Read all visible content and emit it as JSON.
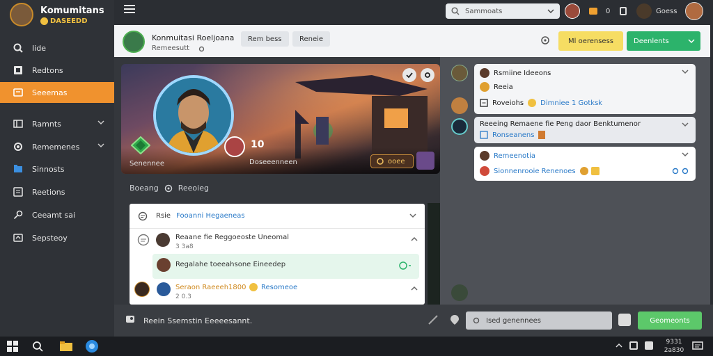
{
  "app": {
    "brand_title": "Komumitans",
    "brand_sub": "ᗞᗅᎴᏋᏚᏒᏒᏫ",
    "brand_sub_text": "DASEEDD"
  },
  "sidebar": {
    "items": [
      {
        "label": "Iide",
        "icon": "search-icon"
      },
      {
        "label": "Redtons",
        "icon": "bookmark-icon"
      },
      {
        "label": "Seeemas",
        "icon": "chat-icon",
        "active": true
      },
      {
        "label": "Ramnts",
        "icon": "grid-icon",
        "has_chevron": true
      },
      {
        "label": "Rememenes",
        "icon": "gear-icon",
        "has_chevron": true
      },
      {
        "label": "Sinnosts",
        "icon": "folder-icon"
      },
      {
        "label": "Reetions",
        "icon": "document-icon"
      },
      {
        "label": "Ceeamt sai",
        "icon": "key-icon"
      },
      {
        "label": "Sepsteoy",
        "icon": "share-icon"
      }
    ]
  },
  "topbar": {
    "search_placeholder": "Sammoats",
    "badge_text": "0",
    "user_name": "Goess"
  },
  "header": {
    "profile_name": "Konmuitasi Roeljoana",
    "profile_sub": "Remeesutt",
    "chips": [
      "Rem bess",
      "Reneie"
    ],
    "btn_yellow": "Ml oerensess",
    "btn_green": "Deenlents"
  },
  "hero": {
    "score": "10",
    "caption": "Senennee",
    "sub_caption": "Doseeenneen",
    "pill_label": "ooee"
  },
  "section": {
    "title_left": "Boeang",
    "title_right": "Reeoieg"
  },
  "comments": {
    "head_label": "Rsie",
    "head_link": "Fooanni Hegaeneas",
    "rows": [
      {
        "text": "Reaane fie Reggoeoste Uneomal",
        "sub": "3 3a8"
      },
      {
        "text": "Regalahe toeeahsone Eineedep",
        "sub": ""
      },
      {
        "text": "Seraon Raeeeh1800",
        "link": "Resomeoe",
        "sub": "2 0.3"
      }
    ]
  },
  "right_panel": {
    "card1": {
      "title": "Rsmiine Ideeons",
      "sub": "Reeia",
      "line": "Roveiohs",
      "link": "Dimniee 1 Gotksk"
    },
    "card2": {
      "title": "Reeeing Remaene fie Peng daor Benktumenor",
      "sub": "Ronseanens"
    },
    "card3": {
      "title": "Remeenotia",
      "line": "Sionnenrooie Renenoes"
    }
  },
  "composer": {
    "text": "Reein Ssemstin Eeeeesannt.",
    "reply_placeholder": "Ised genennees",
    "send_label": "Geomeonts"
  },
  "taskbar": {
    "time": "9331",
    "date": "2a830"
  },
  "colors": {
    "accent_orange": "#f0922e",
    "accent_green": "#2cb36b",
    "accent_yellow": "#f6dd63",
    "sidebar_bg": "#2f3237"
  }
}
